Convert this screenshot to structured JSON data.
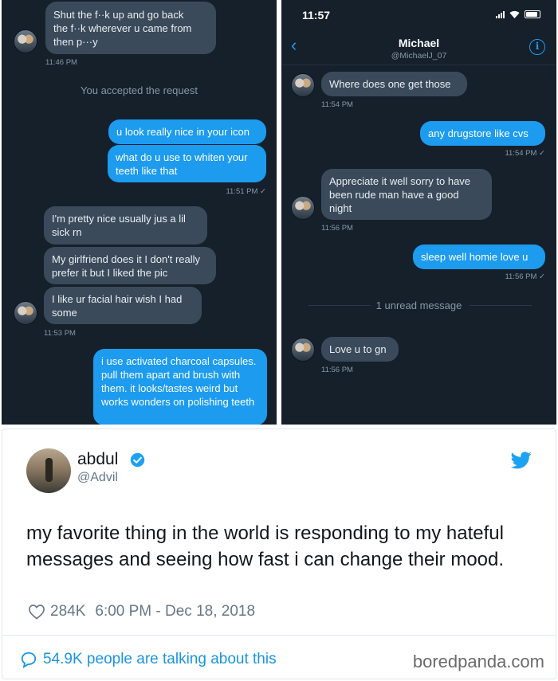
{
  "left_panel": {
    "first_message": "Shut the f**k up and go back the f**k wherever u came from then p***y",
    "first_message_lines": [
      "Shut the f··k up and go back",
      "the f··k wherever u came from",
      "then p···y"
    ],
    "first_time": "11:46 PM",
    "system_note": "You accepted the request",
    "sent_1": "u look really nice in your icon",
    "sent_2": "what do u use to whiten your teeth like that",
    "sent_time": "11:51 PM ✓",
    "reply_1": "I'm pretty nice usually jus a lil sick rn",
    "reply_2": "My girlfriend does it I don't really prefer it but I liked the pic",
    "reply_3": "I like ur facial hair wish I had some",
    "reply_time": "11:53 PM",
    "sent_3": "i use activated charcoal capsules. pull them apart and brush with them. it looks/tastes weird but works wonders on polishing teeth"
  },
  "right_panel": {
    "status_time": "11:57",
    "contact_name": "Michael",
    "contact_handle": "@MichaelJ_07",
    "in_1": "Where does one get those",
    "in_1_time": "11:54 PM",
    "out_1": "any drugstore like cvs",
    "out_1_time": "11:54 PM ✓",
    "in_2": "Appreciate it well sorry to have been rude man have a good night",
    "in_2_time": "11:56 PM",
    "out_2": "sleep well homie love u",
    "out_2_time": "11:56 PM ✓",
    "unread_divider": "1 unread message",
    "in_3": "Love u to gn",
    "in_3_time": "11:56 PM"
  },
  "tweet": {
    "name": "abdul",
    "handle": "@Advil",
    "text": "my favorite thing in the world is responding to my hateful messages and seeing how fast i can change their mood.",
    "likes": "284K",
    "timestamp": "6:00 PM - Dec 18, 2018",
    "talking": "54.9K people are talking about this"
  },
  "watermark": "boredpanda.com",
  "colors": {
    "dm_background": "#15202b",
    "incoming_bubble": "#3a4a5a",
    "outgoing_bubble": "#1c9bef",
    "twitter_blue": "#1b95e0"
  }
}
